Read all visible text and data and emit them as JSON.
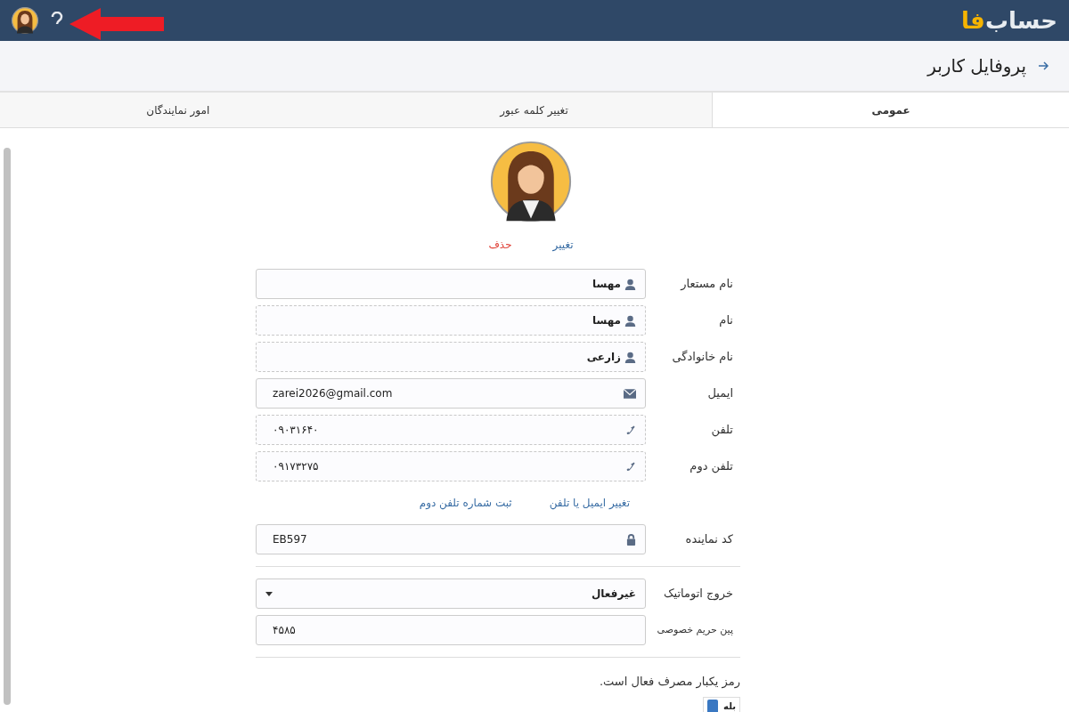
{
  "header": {
    "logo": {
      "text": "حساب",
      "accent": "فا"
    }
  },
  "page_title": "پروفایل کاربر",
  "tabs": [
    {
      "label": "عمومی",
      "selected": true
    },
    {
      "label": "تغییر کلمه عبور",
      "selected": false
    },
    {
      "label": "امور نمایندگان",
      "selected": false
    }
  ],
  "avatar_actions": {
    "change": "تغییر",
    "delete": "حذف"
  },
  "fields": [
    {
      "label": "نام مستعار",
      "value": "مهسا",
      "kind": "user",
      "locked": false
    },
    {
      "label": "نام",
      "value": "مهسا",
      "kind": "user",
      "locked": true
    },
    {
      "label": "نام خانوادگی",
      "value": "زارعی",
      "kind": "user",
      "locked": true
    },
    {
      "label": "ایمیل",
      "value": "zarei2026@gmail.com",
      "kind": "email",
      "locked": false
    },
    {
      "label": "تلفن",
      "value": "۰۹۰۳۱۶۴۰",
      "kind": "phone",
      "locked": true
    },
    {
      "label": "تلفن دوم",
      "value": "۰۹۱۷۳۲۷۵",
      "kind": "phone",
      "locked": true
    }
  ],
  "links": [
    "تغییر ایمیل یا تلفن",
    "ثبت شماره تلفن دوم"
  ],
  "agent_code": {
    "label": "کد نماینده",
    "value": "EB597"
  },
  "auto_logout": {
    "label": "خروج اتوماتیک",
    "value": "غیرفعال"
  },
  "privacy_pin": {
    "label": "پین حریم خصوصی",
    "value": "۴۵۸۵"
  },
  "otp": {
    "text": "رمز یکبار مصرف فعال است.",
    "toggle_label": "بله",
    "checked": true
  }
}
